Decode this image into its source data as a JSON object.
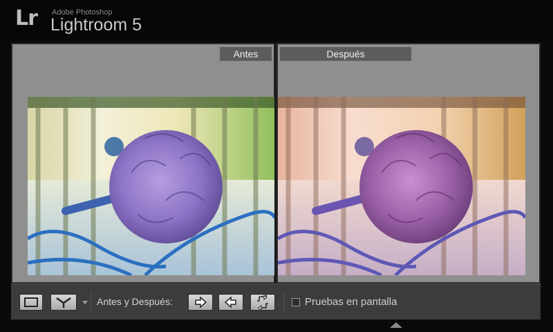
{
  "app": {
    "logo": "Lr",
    "subtitle": "Adobe Photoshop",
    "title": "Lightroom 5"
  },
  "compare": {
    "before_label": "Antes",
    "after_label": "Después"
  },
  "toolbar": {
    "loupe_view_icon": "single-view-icon",
    "compare_view_icon": "before-after-split-icon",
    "label": "Antes y Después:",
    "copy_before_to_after_icon": "arrow-right-icon",
    "copy_after_to_before_icon": "arrow-left-icon",
    "swap_icon": "swap-arrows-icon",
    "soft_proofing_label": "Pruebas en pantalla",
    "soft_proofing_checked": false
  },
  "colors": {
    "background": "#0a0a0a",
    "panel": "#8f8f8f",
    "label_bg": "#5c5c5c",
    "toolbar": "#3c3c3c"
  }
}
